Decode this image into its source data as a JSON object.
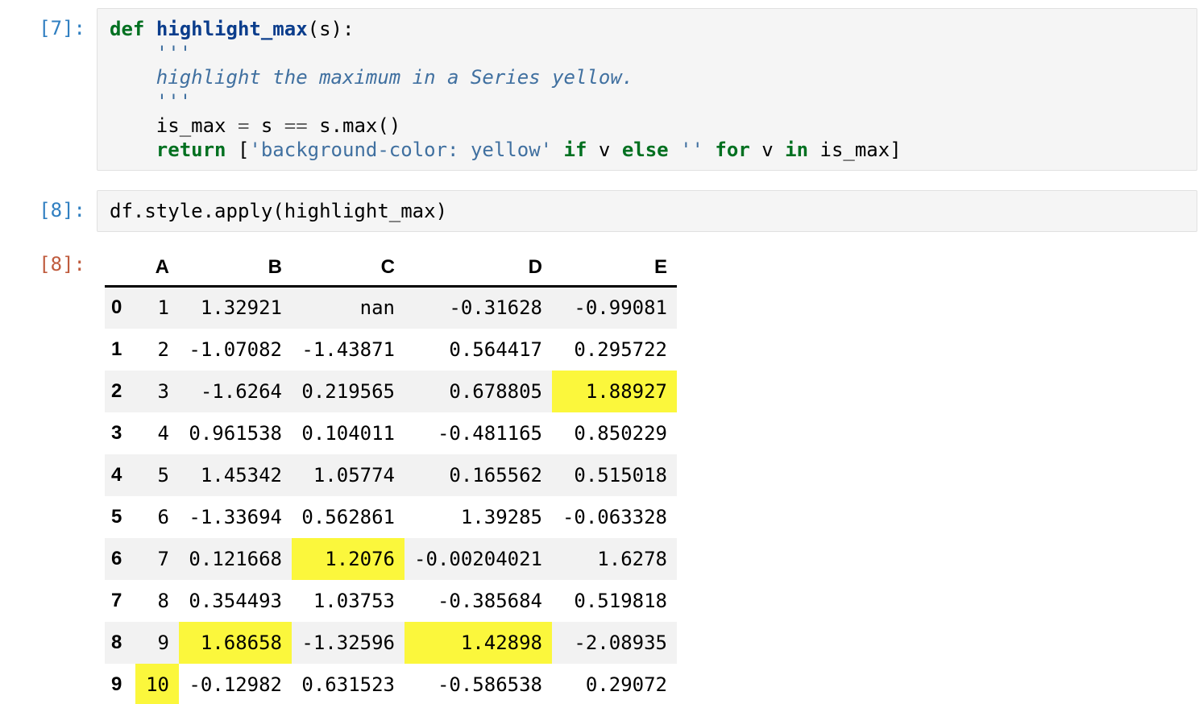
{
  "colors": {
    "input_prompt": "#307fc1",
    "output_prompt": "#bf5b3d",
    "cell_background": "#f5f5f5",
    "cell_border": "#e1e1e1",
    "keyword": "#007020",
    "function_name": "#0b3d8c",
    "string": "#4070a0",
    "operator": "#666666",
    "row_stripe": "#f2f2f2",
    "highlight_yellow": "#fbf73c",
    "header_rule": "#000000"
  },
  "cells": [
    {
      "kind": "code-input",
      "prompt": "[7]:",
      "lines": [
        [
          {
            "t": "kw",
            "v": "def"
          },
          {
            "t": "pl",
            "v": " "
          },
          {
            "t": "fn",
            "v": "highlight_max"
          },
          {
            "t": "pl",
            "v": "(s):"
          }
        ],
        [
          {
            "t": "pl",
            "v": "    "
          },
          {
            "t": "doc",
            "v": "'''"
          }
        ],
        [
          {
            "t": "pl",
            "v": "    "
          },
          {
            "t": "doc",
            "v": "highlight the maximum in a Series yellow."
          }
        ],
        [
          {
            "t": "pl",
            "v": "    "
          },
          {
            "t": "doc",
            "v": "'''"
          }
        ],
        [
          {
            "t": "pl",
            "v": "    is_max "
          },
          {
            "t": "op",
            "v": "="
          },
          {
            "t": "pl",
            "v": " s "
          },
          {
            "t": "op",
            "v": "=="
          },
          {
            "t": "pl",
            "v": " s.max()"
          }
        ],
        [
          {
            "t": "pl",
            "v": "    "
          },
          {
            "t": "kw",
            "v": "return"
          },
          {
            "t": "pl",
            "v": " ["
          },
          {
            "t": "str",
            "v": "'background-color: yellow'"
          },
          {
            "t": "pl",
            "v": " "
          },
          {
            "t": "kw",
            "v": "if"
          },
          {
            "t": "pl",
            "v": " v "
          },
          {
            "t": "kw",
            "v": "else"
          },
          {
            "t": "pl",
            "v": " "
          },
          {
            "t": "str",
            "v": "''"
          },
          {
            "t": "pl",
            "v": " "
          },
          {
            "t": "kw",
            "v": "for"
          },
          {
            "t": "pl",
            "v": " v "
          },
          {
            "t": "kw",
            "v": "in"
          },
          {
            "t": "pl",
            "v": " is_max]"
          }
        ]
      ]
    },
    {
      "kind": "code-input",
      "prompt": "[8]:",
      "lines": [
        [
          {
            "t": "pl",
            "v": "df.style.apply(highlight_max)"
          }
        ]
      ]
    },
    {
      "kind": "output",
      "prompt": "[8]:",
      "table": {
        "columns": [
          "A",
          "B",
          "C",
          "D",
          "E"
        ],
        "rows": [
          {
            "index": "0",
            "values": [
              "1",
              "1.32921",
              "nan",
              "-0.31628",
              "-0.99081"
            ],
            "highlight": []
          },
          {
            "index": "1",
            "values": [
              "2",
              "-1.07082",
              "-1.43871",
              "0.564417",
              "0.295722"
            ],
            "highlight": []
          },
          {
            "index": "2",
            "values": [
              "3",
              "-1.6264",
              "0.219565",
              "0.678805",
              "1.88927"
            ],
            "highlight": [
              4
            ]
          },
          {
            "index": "3",
            "values": [
              "4",
              "0.961538",
              "0.104011",
              "-0.481165",
              "0.850229"
            ],
            "highlight": []
          },
          {
            "index": "4",
            "values": [
              "5",
              "1.45342",
              "1.05774",
              "0.165562",
              "0.515018"
            ],
            "highlight": []
          },
          {
            "index": "5",
            "values": [
              "6",
              "-1.33694",
              "0.562861",
              "1.39285",
              "-0.063328"
            ],
            "highlight": []
          },
          {
            "index": "6",
            "values": [
              "7",
              "0.121668",
              "1.2076",
              "-0.00204021",
              "1.6278"
            ],
            "highlight": [
              2
            ]
          },
          {
            "index": "7",
            "values": [
              "8",
              "0.354493",
              "1.03753",
              "-0.385684",
              "0.519818"
            ],
            "highlight": []
          },
          {
            "index": "8",
            "values": [
              "9",
              "1.68658",
              "-1.32596",
              "1.42898",
              "-2.08935"
            ],
            "highlight": [
              1,
              3
            ]
          },
          {
            "index": "9",
            "values": [
              "10",
              "-0.12982",
              "0.631523",
              "-0.586538",
              "0.29072"
            ],
            "highlight": [
              0
            ]
          }
        ]
      }
    }
  ]
}
